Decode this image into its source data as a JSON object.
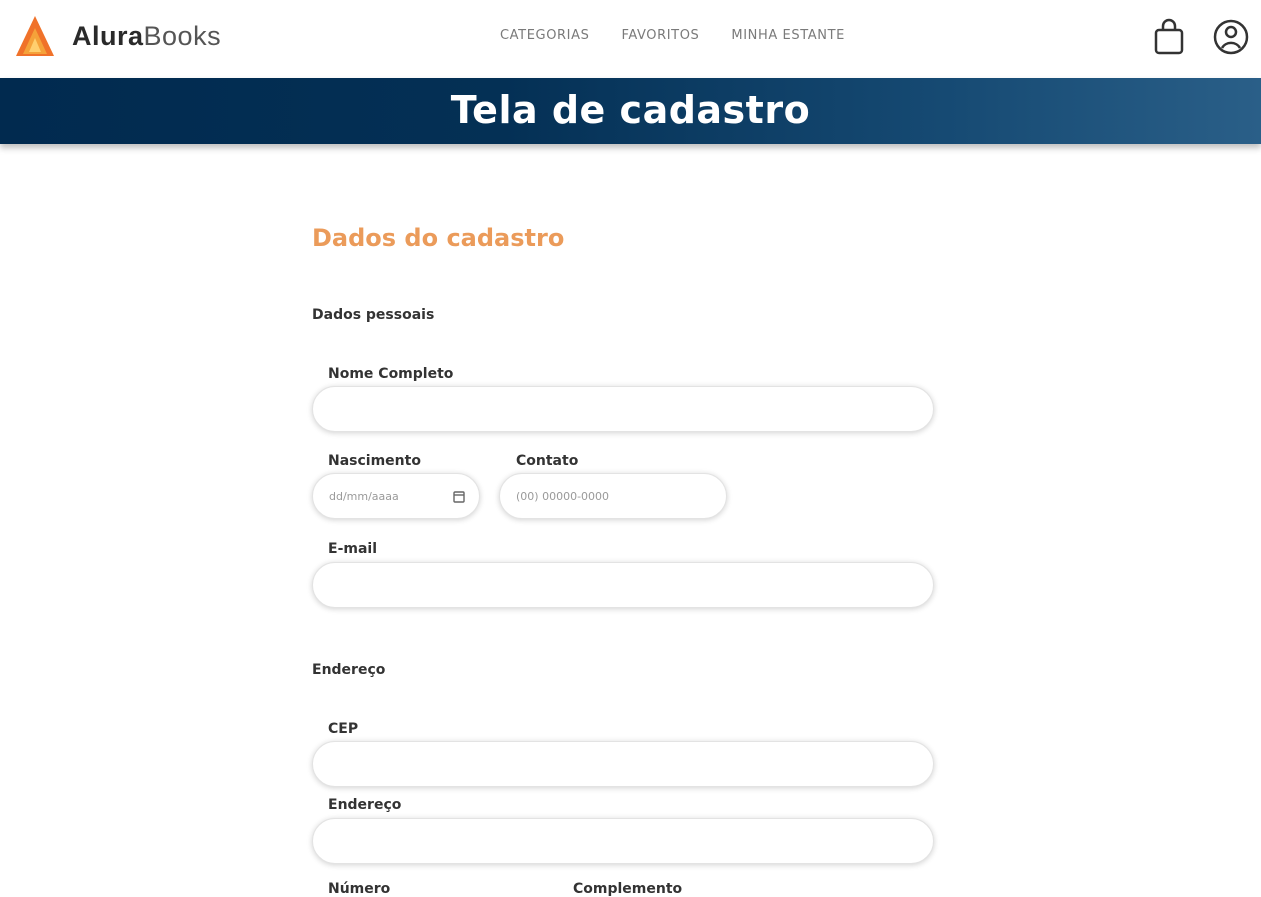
{
  "header": {
    "logo": {
      "brand_bold": "Alura",
      "brand_regular": "Books"
    },
    "nav": [
      {
        "label": "CATEGORIAS"
      },
      {
        "label": "FAVORITOS"
      },
      {
        "label": "MINHA ESTANTE"
      }
    ],
    "icons": {
      "cart": "shopping-bag-icon",
      "profile": "user-icon"
    }
  },
  "banner": {
    "title": "Tela de cadastro"
  },
  "form": {
    "title": "Dados do cadastro",
    "personal": {
      "group_label": "Dados pessoais",
      "full_name": {
        "label": "Nome Completo",
        "value": ""
      },
      "birth": {
        "label": "Nascimento",
        "placeholder": "dd/mm/aaaa"
      },
      "contact": {
        "label": "Contato",
        "placeholder": "(00) 00000-0000"
      },
      "email": {
        "label": "E-mail",
        "value": ""
      }
    },
    "address": {
      "group_label": "Endereço",
      "cep": {
        "label": "CEP",
        "value": ""
      },
      "street": {
        "label": "Endereço",
        "value": ""
      },
      "number": {
        "label": "Número"
      },
      "complement": {
        "label": "Complemento"
      }
    }
  },
  "colors": {
    "accent": "#eb9b5a",
    "banner_start": "#012a4f",
    "banner_end": "#2a5f88",
    "logo_orange": "#f0722a"
  }
}
